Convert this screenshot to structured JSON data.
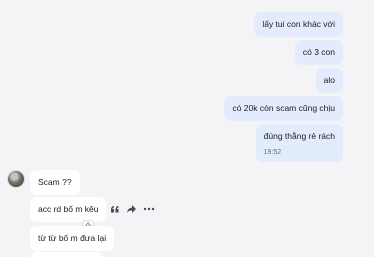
{
  "messages_out": [
    {
      "text": "lấy tui con khác với"
    },
    {
      "text": "có 3 con"
    },
    {
      "text": "alo"
    },
    {
      "text": "có 20k còn scam cũng chịu"
    },
    {
      "text": "đúng thằng rẻ rách",
      "time": "19:52"
    }
  ],
  "messages_in": [
    {
      "text": "Scam ??"
    },
    {
      "text": "acc rd bố m kêu"
    },
    {
      "text": "từ từ bố m đưa lại"
    }
  ],
  "icons": {
    "quote": "quote-icon",
    "forward": "forward-icon",
    "more": "more-dots-icon",
    "reaction": "thumbs-up-icon"
  }
}
